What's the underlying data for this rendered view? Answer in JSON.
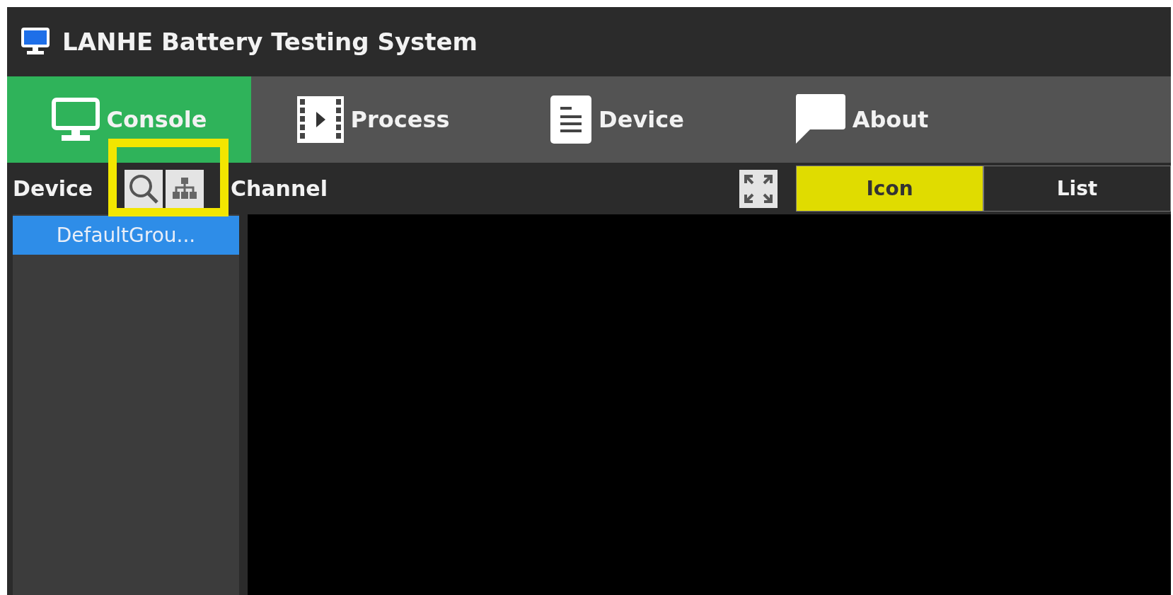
{
  "window": {
    "title": "LANHE Battery Testing System"
  },
  "tabs": [
    {
      "label": "Console",
      "selected": true
    },
    {
      "label": "Process",
      "selected": false
    },
    {
      "label": "Device",
      "selected": false
    },
    {
      "label": "About",
      "selected": false
    }
  ],
  "toolbar": {
    "device_label": "Device",
    "channel_label": "Channel",
    "view_modes": [
      {
        "label": "Icon",
        "selected": true
      },
      {
        "label": "List",
        "selected": false
      }
    ]
  },
  "device_groups": [
    {
      "label": "DefaultGrou...",
      "selected": true
    }
  ]
}
